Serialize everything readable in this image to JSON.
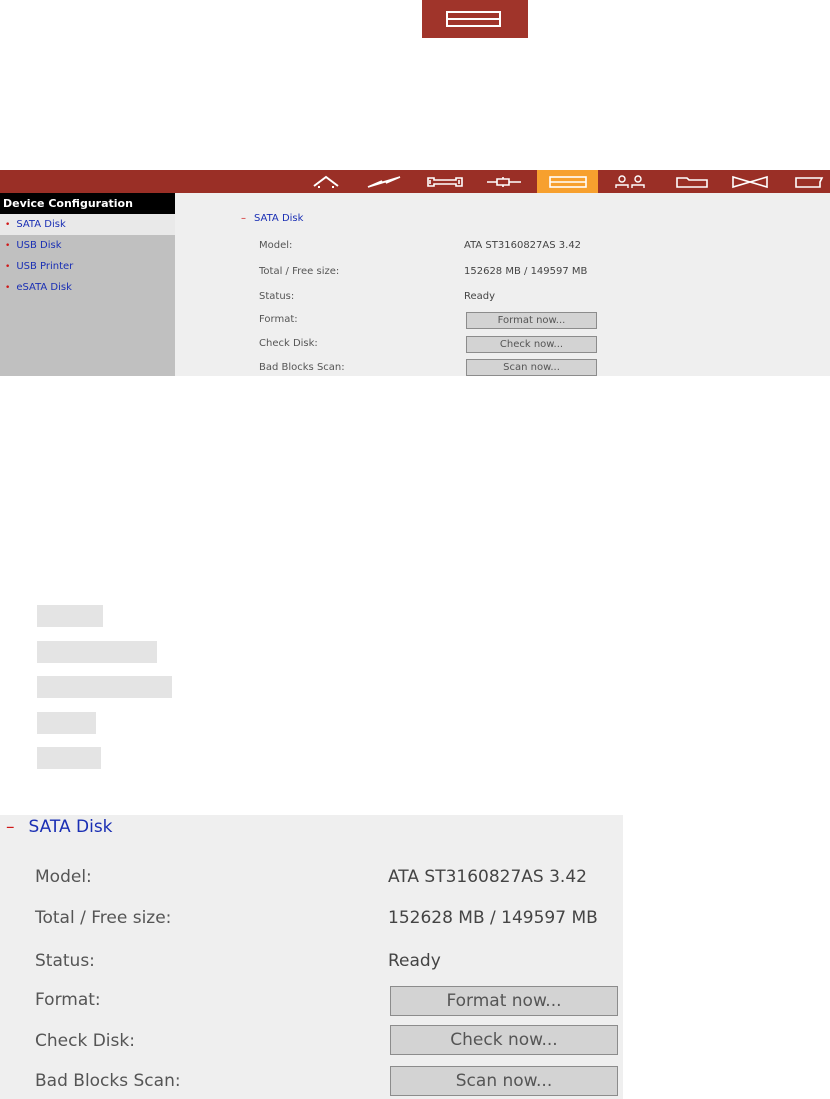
{
  "nav": {
    "icons": [
      "home-icon",
      "bolt-icon",
      "wrench-icon",
      "plug-icon",
      "disk-icon",
      "users-icon",
      "folder-icon",
      "network-icon",
      "document-icon"
    ],
    "active_index": 4,
    "bar_color": "#9a2f26",
    "active_color": "#f7a02e"
  },
  "sidebar": {
    "header": "Device Configuration",
    "items": [
      {
        "label": "SATA Disk"
      },
      {
        "label": "USB Disk"
      },
      {
        "label": "USB Printer"
      },
      {
        "label": "eSATA Disk"
      }
    ]
  },
  "content": {
    "section_title": "SATA Disk",
    "model_label": "Model:",
    "model_value": "ATA ST3160827AS 3.42",
    "size_label": "Total / Free size:",
    "size_value": "152628 MB / 149597 MB",
    "status_label": "Status:",
    "status_value": "Ready",
    "format_label": "Format:",
    "format_button": "Format now...",
    "check_label": "Check Disk:",
    "check_button": "Check now...",
    "scan_label": "Bad Blocks Scan:",
    "scan_button": "Scan now..."
  }
}
